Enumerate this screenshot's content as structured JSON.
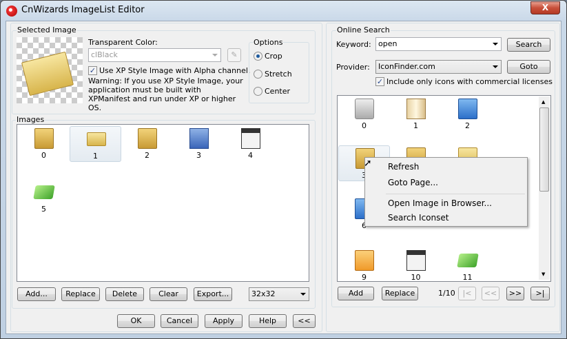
{
  "window": {
    "title": "CnWizards ImageList Editor",
    "close": "X"
  },
  "selected": {
    "label": "Selected Image",
    "transparent_label": "Transparent Color:",
    "transparent_value": "clBlack",
    "use_xp_label": "Use XP Style Image with Alpha channel.",
    "use_xp_checked": true,
    "warning": "Warning: If you use XP Style Image, your application must be built with XPManifest and run under XP or higher OS.",
    "options": {
      "label": "Options",
      "items": [
        {
          "label": "Crop",
          "selected": true
        },
        {
          "label": "Stretch",
          "selected": false
        },
        {
          "label": "Center",
          "selected": false
        }
      ]
    }
  },
  "images": {
    "label": "Images",
    "items": [
      {
        "label": "0",
        "icon": "folder-arrow-icon"
      },
      {
        "label": "1",
        "icon": "envelope-open-icon",
        "selected": true
      },
      {
        "label": "2",
        "icon": "folder-open-icon"
      },
      {
        "label": "3",
        "icon": "blue-book-icon"
      },
      {
        "label": "4",
        "icon": "window-icon"
      },
      {
        "label": "5",
        "icon": "checkmark-icon"
      }
    ],
    "buttons": {
      "add": "Add...",
      "replace": "Replace",
      "delete": "Delete",
      "clear": "Clear",
      "export": "Export..."
    },
    "size": "32x32"
  },
  "footer": {
    "ok": "OK",
    "cancel": "Cancel",
    "apply": "Apply",
    "help": "Help",
    "collapse": "<<"
  },
  "online": {
    "label": "Online Search",
    "keyword_label": "Keyword:",
    "keyword": "open",
    "search": "Search",
    "provider_label": "Provider:",
    "provider": "IconFinder.com",
    "goto": "Goto",
    "commercial_label": "Include only icons with commercial licenses",
    "commercial_checked": true,
    "items": [
      {
        "label": "0",
        "icon": "lock-icon"
      },
      {
        "label": "1",
        "icon": "book-icon"
      },
      {
        "label": "2",
        "icon": "home-folder-icon"
      },
      {
        "label": "3",
        "icon": "folder-refresh-icon"
      },
      {
        "label": "",
        "icon": "folder-icon"
      },
      {
        "label": "",
        "icon": "envelope-icon"
      },
      {
        "label": "6",
        "icon": "blue-folder-icon"
      },
      {
        "label": "9",
        "icon": "orange-folder-icon"
      },
      {
        "label": "10",
        "icon": "window-icon"
      },
      {
        "label": "11",
        "icon": "checkmark-icon"
      }
    ],
    "add": "Add",
    "replace": "Replace",
    "page": "1/10",
    "first": "|<",
    "prev": "<<",
    "next": ">>",
    "last": ">|"
  },
  "context_menu": {
    "items": [
      "Refresh",
      "Goto Page...",
      "Open Image in Browser...",
      "Search Iconset"
    ]
  }
}
